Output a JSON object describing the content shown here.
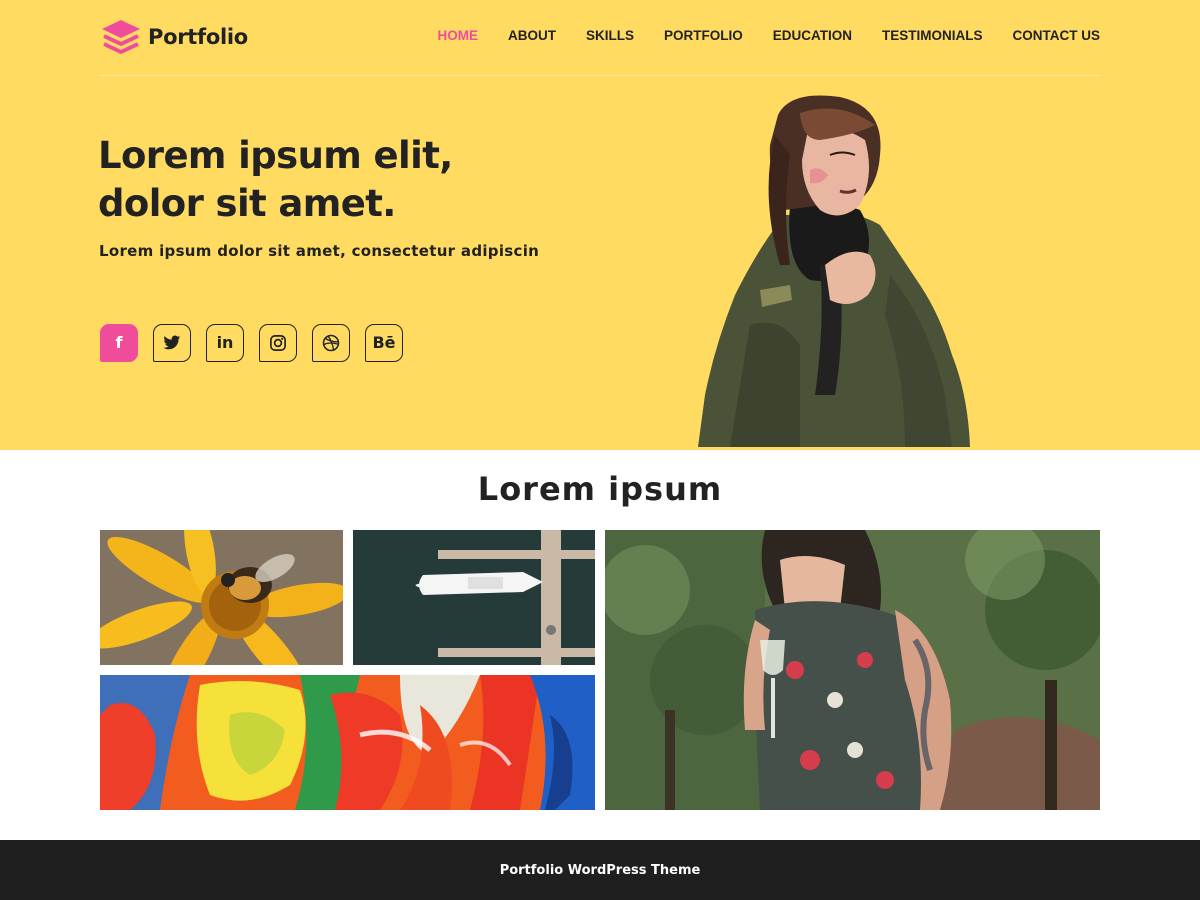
{
  "header": {
    "brand_name": "Portfolio",
    "nav": [
      {
        "label": "HOME",
        "active": true
      },
      {
        "label": "ABOUT"
      },
      {
        "label": "SKILLS"
      },
      {
        "label": "PORTFOLIO"
      },
      {
        "label": "EDUCATION"
      },
      {
        "label": "TESTIMONIALS"
      },
      {
        "label": "CONTACT US"
      }
    ]
  },
  "hero": {
    "title_line1": "Lorem ipsum elit,",
    "title_line2": "dolor sit amet.",
    "subtitle": "Lorem ipsum dolor sit amet, consectetur adipiscin",
    "socials": [
      {
        "icon": "facebook-icon",
        "glyph": "f"
      },
      {
        "icon": "twitter-icon"
      },
      {
        "icon": "linkedin-icon",
        "glyph": "in"
      },
      {
        "icon": "instagram-icon"
      },
      {
        "icon": "dribbble-icon"
      },
      {
        "icon": "behance-icon",
        "glyph": "Bē"
      }
    ],
    "image": "woman-in-green-jacket"
  },
  "gallery": {
    "title": "Lorem ipsum",
    "images": [
      "bee-on-yellow-flower",
      "aerial-boat-at-dock",
      "colorful-abstract-paint",
      "woman-with-wine-glass"
    ]
  },
  "footer": {
    "text": "Portfolio WordPress Theme"
  },
  "colors": {
    "hero_bg": "#ffdb62",
    "accent": "#ef4d9c",
    "text": "#222222",
    "footer_bg": "#1f1f1f"
  }
}
